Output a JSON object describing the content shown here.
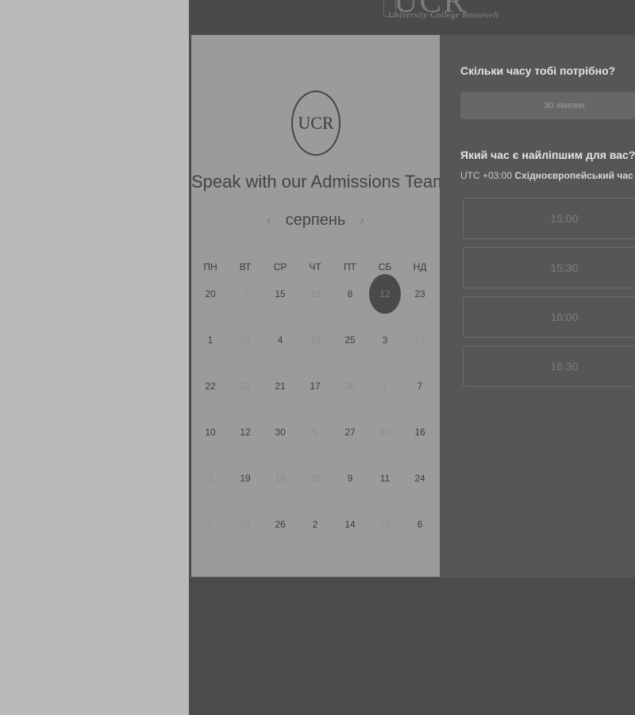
{
  "header": {
    "logo_mark": "UCR",
    "logo_text": "University College Roosevelt"
  },
  "calendar": {
    "logo": "UCR",
    "title": "Speak with our Admissions Team",
    "month": "серпень",
    "prev_arrow": "‹",
    "next_arrow": "›",
    "weekdays": [
      "ПН",
      "ВТ",
      "СР",
      "ЧТ",
      "ПТ",
      "СБ",
      "НД"
    ],
    "weeks": [
      [
        {
          "d": "20"
        },
        {
          "d": "7",
          "faded": true
        },
        {
          "d": "15"
        },
        {
          "d": "19",
          "faded": true
        },
        {
          "d": "8"
        },
        {
          "d": "12",
          "selected": true
        },
        {
          "d": "23"
        }
      ],
      [
        {
          "d": "1"
        },
        {
          "d": "28",
          "faded": true
        },
        {
          "d": "4"
        },
        {
          "d": "19",
          "faded": true
        },
        {
          "d": "25"
        },
        {
          "d": "3"
        },
        {
          "d": "27",
          "faded": true
        }
      ],
      [
        {
          "d": "22"
        },
        {
          "d": "23",
          "faded": true
        },
        {
          "d": "21"
        },
        {
          "d": "17"
        },
        {
          "d": "26",
          "faded": true
        },
        {
          "d": "1",
          "faded": true
        },
        {
          "d": "7"
        }
      ],
      [
        {
          "d": "10"
        },
        {
          "d": "12"
        },
        {
          "d": "30"
        },
        {
          "d": "5",
          "faded": true
        },
        {
          "d": "27"
        },
        {
          "d": "30",
          "faded": true
        },
        {
          "d": "16"
        }
      ],
      [
        {
          "d": "3",
          "faded": true
        },
        {
          "d": "19"
        },
        {
          "d": "16",
          "faded": true
        },
        {
          "d": "29",
          "faded": true
        },
        {
          "d": "9"
        },
        {
          "d": "11"
        },
        {
          "d": "24"
        }
      ],
      [
        {
          "d": "7",
          "faded": true
        },
        {
          "d": "28",
          "faded": true
        },
        {
          "d": "26"
        },
        {
          "d": "2"
        },
        {
          "d": "14"
        },
        {
          "d": "18",
          "faded": true
        },
        {
          "d": "6"
        }
      ]
    ]
  },
  "booking": {
    "duration_question": "Скільки часу тобі потрібно?",
    "duration_label": "30 хвилин",
    "time_question": "Який час є найліпшим для вас?",
    "timezone_offset": "UTC +03:00",
    "timezone_name": "Східноєвропейський час",
    "timezone_caret": "▾",
    "slots": [
      "15:00",
      "15:30",
      "16:00",
      "16:30"
    ]
  }
}
